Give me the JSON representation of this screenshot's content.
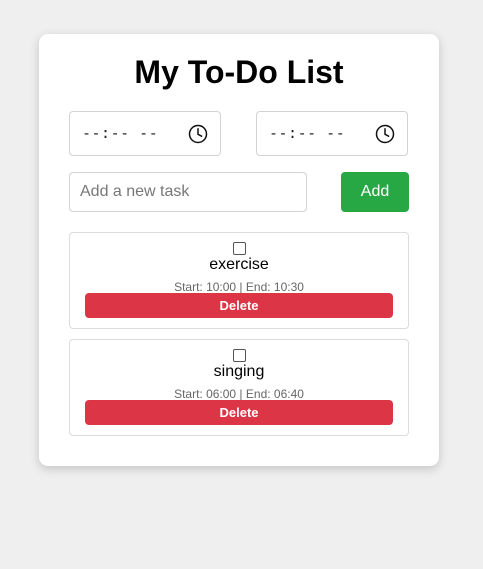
{
  "app": {
    "title": "My To-Do List"
  },
  "start_time": {
    "value": "--:-- --",
    "icon": "clock-icon"
  },
  "end_time": {
    "value": "--:-- --",
    "icon": "clock-icon"
  },
  "new_task": {
    "value": "",
    "placeholder": "Add a new task"
  },
  "add_button": {
    "label": "Add",
    "color": "#28a745"
  },
  "tasks": [
    {
      "name": "exercise",
      "checked": false,
      "time_text": "Start: 10:00 | End: 10:30",
      "delete_label": "Delete"
    },
    {
      "name": "singing",
      "checked": false,
      "time_text": "Start: 06:00 | End: 06:40",
      "delete_label": "Delete"
    }
  ],
  "colors": {
    "delete": "#dc3545",
    "background": "#efefef",
    "card": "#ffffff"
  }
}
